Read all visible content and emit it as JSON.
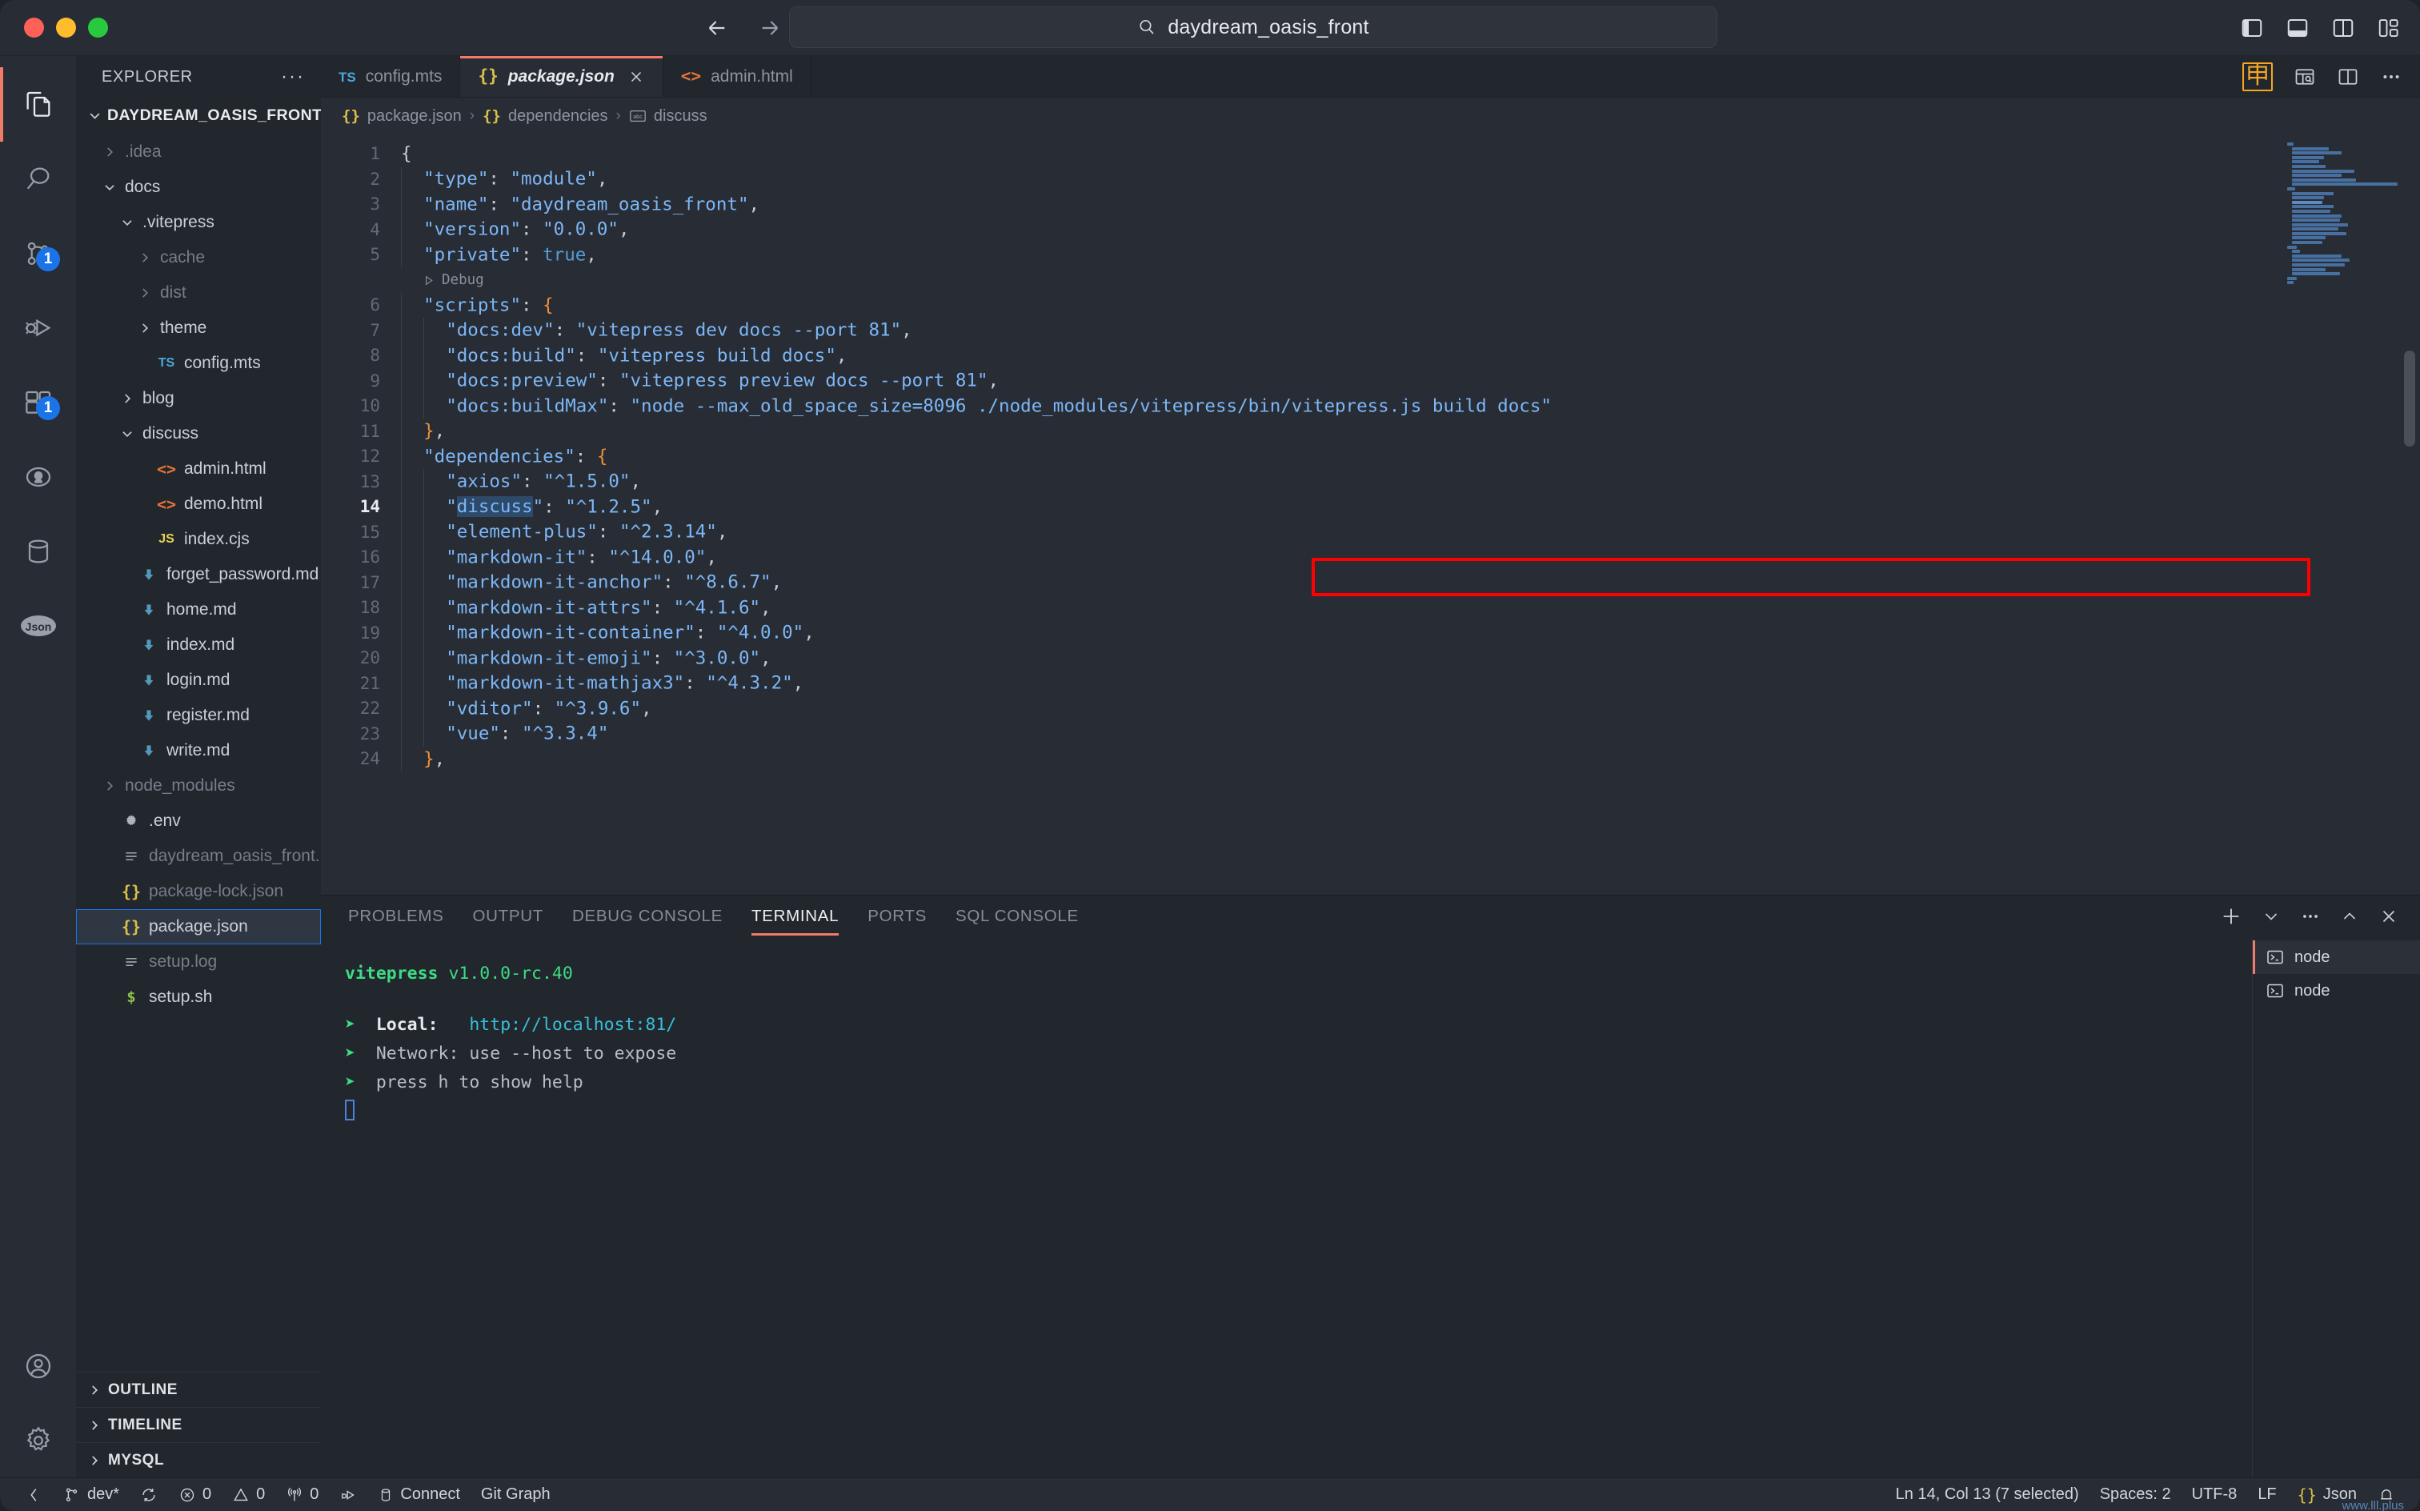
{
  "titlebar": {
    "search_text": "daydream_oasis_front",
    "search_icon": "search-icon",
    "back_icon": "back-arrow-icon",
    "forward_icon": "forward-arrow-icon",
    "layout_icons": [
      "toggle-primary-sidebar-icon",
      "toggle-panel-icon",
      "toggle-secondary-sidebar-icon",
      "customize-layout-icon"
    ]
  },
  "activitybar": {
    "items": [
      {
        "name": "explorer",
        "icon": "files-icon",
        "badge": ""
      },
      {
        "name": "search",
        "icon": "search-icon",
        "badge": ""
      },
      {
        "name": "source-control",
        "icon": "source-control-icon",
        "badge": "1"
      },
      {
        "name": "run-and-debug",
        "icon": "debug-icon",
        "badge": ""
      },
      {
        "name": "extensions",
        "icon": "extensions-icon",
        "badge": "1"
      },
      {
        "name": "github",
        "icon": "github-icon",
        "badge": ""
      },
      {
        "name": "database",
        "icon": "database-icon",
        "badge": ""
      },
      {
        "name": "json-viewer",
        "icon": "json-icon",
        "badge": ""
      }
    ],
    "bottom": [
      {
        "name": "accounts",
        "icon": "account-icon"
      },
      {
        "name": "settings",
        "icon": "gear-icon"
      }
    ]
  },
  "sidebar": {
    "title": "EXPLORER",
    "more_label": "···",
    "root": {
      "label": "DAYDREAM_OASIS_FRONT",
      "expanded": true,
      "actions": [
        "new-file-icon",
        "new-folder-icon",
        "refresh-icon",
        "collapse-all-icon"
      ]
    },
    "tree": [
      {
        "label": ".idea",
        "indent": 1,
        "type": "folder",
        "expanded": false,
        "dim": true
      },
      {
        "label": "docs",
        "indent": 1,
        "type": "folder",
        "expanded": true,
        "dim": false
      },
      {
        "label": ".vitepress",
        "indent": 2,
        "type": "folder",
        "expanded": true,
        "dim": false
      },
      {
        "label": "cache",
        "indent": 3,
        "type": "folder",
        "expanded": false,
        "dim": true
      },
      {
        "label": "dist",
        "indent": 3,
        "type": "folder",
        "expanded": false,
        "dim": true
      },
      {
        "label": "theme",
        "indent": 3,
        "type": "folder",
        "expanded": false,
        "dim": false
      },
      {
        "label": "config.mts",
        "indent": 3,
        "type": "ts",
        "dim": false
      },
      {
        "label": "blog",
        "indent": 2,
        "type": "folder",
        "expanded": false,
        "dim": false
      },
      {
        "label": "discuss",
        "indent": 2,
        "type": "folder",
        "expanded": true,
        "dim": false
      },
      {
        "label": "admin.html",
        "indent": 3,
        "type": "html",
        "dim": false
      },
      {
        "label": "demo.html",
        "indent": 3,
        "type": "html",
        "dim": false
      },
      {
        "label": "index.cjs",
        "indent": 3,
        "type": "js",
        "dim": false
      },
      {
        "label": "forget_password.md",
        "indent": 2,
        "type": "md",
        "dim": false
      },
      {
        "label": "home.md",
        "indent": 2,
        "type": "md",
        "dim": false
      },
      {
        "label": "index.md",
        "indent": 2,
        "type": "md",
        "dim": false
      },
      {
        "label": "login.md",
        "indent": 2,
        "type": "md",
        "dim": false
      },
      {
        "label": "register.md",
        "indent": 2,
        "type": "md",
        "dim": false
      },
      {
        "label": "write.md",
        "indent": 2,
        "type": "md",
        "dim": false
      },
      {
        "label": "node_modules",
        "indent": 1,
        "type": "folder",
        "expanded": false,
        "dim": true
      },
      {
        "label": ".env",
        "indent": 1,
        "type": "env",
        "dim": false
      },
      {
        "label": "daydream_oasis_front.log",
        "indent": 1,
        "type": "log",
        "dim": true
      },
      {
        "label": "package-lock.json",
        "indent": 1,
        "type": "json",
        "dim": true
      },
      {
        "label": "package.json",
        "indent": 1,
        "type": "json",
        "dim": false,
        "selected": true
      },
      {
        "label": "setup.log",
        "indent": 1,
        "type": "log",
        "dim": true
      },
      {
        "label": "setup.sh",
        "indent": 1,
        "type": "sh",
        "dim": false
      }
    ],
    "sections": [
      {
        "label": "OUTLINE"
      },
      {
        "label": "TIMELINE"
      },
      {
        "label": "MYSQL"
      }
    ]
  },
  "editor": {
    "tabs": [
      {
        "label": "config.mts",
        "icon": "ts-file-icon",
        "active": false,
        "closable": false
      },
      {
        "label": "package.json",
        "icon": "json-file-icon",
        "active": true,
        "closable": true
      },
      {
        "label": "admin.html",
        "icon": "html-file-icon",
        "active": false,
        "closable": false
      }
    ],
    "toolbar": [
      {
        "name": "chinese-ime-icon",
        "glyph": "申"
      },
      {
        "name": "open-preview-icon"
      },
      {
        "name": "split-editor-icon"
      },
      {
        "name": "more-actions-icon",
        "glyph": "···"
      }
    ],
    "breadcrumb": [
      {
        "label": "package.json",
        "icon": "json-file-icon"
      },
      {
        "label": "dependencies",
        "icon": "json-object-icon"
      },
      {
        "label": "discuss",
        "icon": "abc-property-icon"
      }
    ],
    "codelens": {
      "label": "Debug",
      "icon": "play-icon",
      "line": 6
    },
    "current_line": 14,
    "lines": [
      {
        "n": 1,
        "depth": 0,
        "tokens": [
          {
            "t": "{",
            "c": "p"
          }
        ]
      },
      {
        "n": 2,
        "depth": 1,
        "tokens": [
          {
            "t": "\"type\"",
            "c": "k"
          },
          {
            "t": ": ",
            "c": "p"
          },
          {
            "t": "\"module\"",
            "c": "s"
          },
          {
            "t": ",",
            "c": "p"
          }
        ]
      },
      {
        "n": 3,
        "depth": 1,
        "tokens": [
          {
            "t": "\"name\"",
            "c": "k"
          },
          {
            "t": ": ",
            "c": "p"
          },
          {
            "t": "\"daydream_oasis_front\"",
            "c": "s"
          },
          {
            "t": ",",
            "c": "p"
          }
        ]
      },
      {
        "n": 4,
        "depth": 1,
        "tokens": [
          {
            "t": "\"version\"",
            "c": "k"
          },
          {
            "t": ": ",
            "c": "p"
          },
          {
            "t": "\"0.0.0\"",
            "c": "s"
          },
          {
            "t": ",",
            "c": "p"
          }
        ]
      },
      {
        "n": 5,
        "depth": 1,
        "tokens": [
          {
            "t": "\"private\"",
            "c": "k"
          },
          {
            "t": ": ",
            "c": "p"
          },
          {
            "t": "true",
            "c": "bool"
          },
          {
            "t": ",",
            "c": "p"
          }
        ]
      },
      {
        "n": 6,
        "depth": 1,
        "tokens": [
          {
            "t": "\"scripts\"",
            "c": "k"
          },
          {
            "t": ": ",
            "c": "p"
          },
          {
            "t": "{",
            "c": "b"
          }
        ]
      },
      {
        "n": 7,
        "depth": 2,
        "tokens": [
          {
            "t": "\"docs:dev\"",
            "c": "k"
          },
          {
            "t": ": ",
            "c": "p"
          },
          {
            "t": "\"vitepress dev docs --port 81\"",
            "c": "s"
          },
          {
            "t": ",",
            "c": "p"
          }
        ]
      },
      {
        "n": 8,
        "depth": 2,
        "tokens": [
          {
            "t": "\"docs:build\"",
            "c": "k"
          },
          {
            "t": ": ",
            "c": "p"
          },
          {
            "t": "\"vitepress build docs\"",
            "c": "s"
          },
          {
            "t": ",",
            "c": "p"
          }
        ]
      },
      {
        "n": 9,
        "depth": 2,
        "tokens": [
          {
            "t": "\"docs:preview\"",
            "c": "k"
          },
          {
            "t": ": ",
            "c": "p"
          },
          {
            "t": "\"vitepress preview docs --port 81\"",
            "c": "s"
          },
          {
            "t": ",",
            "c": "p"
          }
        ]
      },
      {
        "n": 10,
        "depth": 2,
        "tokens": [
          {
            "t": "\"docs:buildMax\"",
            "c": "k"
          },
          {
            "t": ": ",
            "c": "p"
          },
          {
            "t": "\"node --max_old_space_size=8096 ./node_modules/vitepress/bin/vitepress.js build docs\"",
            "c": "s"
          }
        ]
      },
      {
        "n": 11,
        "depth": 1,
        "tokens": [
          {
            "t": "}",
            "c": "b"
          },
          {
            "t": ",",
            "c": "p"
          }
        ]
      },
      {
        "n": 12,
        "depth": 1,
        "tokens": [
          {
            "t": "\"dependencies\"",
            "c": "k"
          },
          {
            "t": ": ",
            "c": "p"
          },
          {
            "t": "{",
            "c": "b"
          }
        ]
      },
      {
        "n": 13,
        "depth": 2,
        "tokens": [
          {
            "t": "\"axios\"",
            "c": "k"
          },
          {
            "t": ": ",
            "c": "p"
          },
          {
            "t": "\"^1.5.0\"",
            "c": "s"
          },
          {
            "t": ",",
            "c": "p"
          }
        ]
      },
      {
        "n": 14,
        "depth": 2,
        "tokens": [
          {
            "t": "\"",
            "c": "k"
          },
          {
            "t": "discuss",
            "c": "k sel"
          },
          {
            "t": "\"",
            "c": "k"
          },
          {
            "t": ": ",
            "c": "p"
          },
          {
            "t": "\"^1.2.5\"",
            "c": "s"
          },
          {
            "t": ",",
            "c": "p"
          }
        ]
      },
      {
        "n": 15,
        "depth": 2,
        "tokens": [
          {
            "t": "\"element-plus\"",
            "c": "k"
          },
          {
            "t": ": ",
            "c": "p"
          },
          {
            "t": "\"^2.3.14\"",
            "c": "s"
          },
          {
            "t": ",",
            "c": "p"
          }
        ]
      },
      {
        "n": 16,
        "depth": 2,
        "tokens": [
          {
            "t": "\"markdown-it\"",
            "c": "k"
          },
          {
            "t": ": ",
            "c": "p"
          },
          {
            "t": "\"^14.0.0\"",
            "c": "s"
          },
          {
            "t": ",",
            "c": "p"
          }
        ]
      },
      {
        "n": 17,
        "depth": 2,
        "tokens": [
          {
            "t": "\"markdown-it-anchor\"",
            "c": "k"
          },
          {
            "t": ": ",
            "c": "p"
          },
          {
            "t": "\"^8.6.7\"",
            "c": "s"
          },
          {
            "t": ",",
            "c": "p"
          }
        ]
      },
      {
        "n": 18,
        "depth": 2,
        "tokens": [
          {
            "t": "\"markdown-it-attrs\"",
            "c": "k"
          },
          {
            "t": ": ",
            "c": "p"
          },
          {
            "t": "\"^4.1.6\"",
            "c": "s"
          },
          {
            "t": ",",
            "c": "p"
          }
        ]
      },
      {
        "n": 19,
        "depth": 2,
        "tokens": [
          {
            "t": "\"markdown-it-container\"",
            "c": "k"
          },
          {
            "t": ": ",
            "c": "p"
          },
          {
            "t": "\"^4.0.0\"",
            "c": "s"
          },
          {
            "t": ",",
            "c": "p"
          }
        ]
      },
      {
        "n": 20,
        "depth": 2,
        "tokens": [
          {
            "t": "\"markdown-it-emoji\"",
            "c": "k"
          },
          {
            "t": ": ",
            "c": "p"
          },
          {
            "t": "\"^3.0.0\"",
            "c": "s"
          },
          {
            "t": ",",
            "c": "p"
          }
        ]
      },
      {
        "n": 21,
        "depth": 2,
        "tokens": [
          {
            "t": "\"markdown-it-mathjax3\"",
            "c": "k"
          },
          {
            "t": ": ",
            "c": "p"
          },
          {
            "t": "\"^4.3.2\"",
            "c": "s"
          },
          {
            "t": ",",
            "c": "p"
          }
        ]
      },
      {
        "n": 22,
        "depth": 2,
        "tokens": [
          {
            "t": "\"vditor\"",
            "c": "k"
          },
          {
            "t": ": ",
            "c": "p"
          },
          {
            "t": "\"^3.9.6\"",
            "c": "s"
          },
          {
            "t": ",",
            "c": "p"
          }
        ]
      },
      {
        "n": 23,
        "depth": 2,
        "tokens": [
          {
            "t": "\"vue\"",
            "c": "k"
          },
          {
            "t": ": ",
            "c": "p"
          },
          {
            "t": "\"^3.3.4\"",
            "c": "s"
          }
        ]
      },
      {
        "n": 24,
        "depth": 1,
        "tokens": [
          {
            "t": "}",
            "c": "b"
          },
          {
            "t": ",",
            "c": "p"
          }
        ]
      }
    ],
    "highlight": {
      "name": "red-annotation-box",
      "color": "#ff0000",
      "line": 10
    }
  },
  "panel": {
    "tabs": [
      {
        "label": "PROBLEMS",
        "active": false
      },
      {
        "label": "OUTPUT",
        "active": false
      },
      {
        "label": "DEBUG CONSOLE",
        "active": false
      },
      {
        "label": "TERMINAL",
        "active": true
      },
      {
        "label": "PORTS",
        "active": false
      },
      {
        "label": "SQL CONSOLE",
        "active": false
      }
    ],
    "actions": [
      {
        "name": "new-terminal-icon",
        "glyph": "+"
      },
      {
        "name": "terminal-dropdown-icon",
        "glyph": "⌄"
      },
      {
        "name": "panel-more-icon",
        "glyph": "···"
      },
      {
        "name": "maximize-panel-icon",
        "glyph": "^"
      },
      {
        "name": "close-panel-icon",
        "glyph": "✕"
      }
    ],
    "terminal": {
      "header_name": "vitepress",
      "header_version": "v1.0.0-rc.40",
      "rows": [
        {
          "arrow": "➜",
          "label": "Local:",
          "sep": "   ",
          "value": "http://localhost:81/",
          "value_class": "cy",
          "label_class": "w"
        },
        {
          "arrow": "➜",
          "label": "Network:",
          "sep": " ",
          "value": "use --host to expose",
          "value_class": "",
          "label_class": ""
        },
        {
          "arrow": "➜",
          "label": "press h to show help",
          "sep": "",
          "value": "",
          "value_class": "",
          "label_class": ""
        }
      ],
      "cursor": "block-cursor"
    },
    "terminal_list": [
      {
        "label": "node",
        "icon": "terminal-icon",
        "active": true
      },
      {
        "label": "node",
        "icon": "terminal-icon",
        "active": false
      }
    ]
  },
  "statusbar": {
    "left": [
      {
        "name": "remote-window",
        "icon": "remote-icon",
        "label": ""
      },
      {
        "name": "branch",
        "icon": "branch-icon",
        "label": "dev*"
      },
      {
        "name": "sync",
        "icon": "sync-icon",
        "label": ""
      },
      {
        "name": "errors",
        "icon": "error-icon",
        "label": "0"
      },
      {
        "name": "warnings",
        "icon": "warning-icon",
        "label": "0"
      },
      {
        "name": "radio-tower",
        "icon": "radio-tower-icon",
        "label": "0"
      },
      {
        "name": "debug-start",
        "icon": "debug-icon",
        "label": ""
      },
      {
        "name": "database-connect",
        "icon": "database-icon",
        "label": "Connect"
      },
      {
        "name": "git-graph",
        "icon": "",
        "label": "Git Graph"
      }
    ],
    "right": [
      {
        "name": "cursor-position",
        "label": "Ln 14, Col 13 (7 selected)"
      },
      {
        "name": "indentation",
        "label": "Spaces: 2"
      },
      {
        "name": "encoding",
        "label": "UTF-8"
      },
      {
        "name": "eol",
        "label": "LF"
      },
      {
        "name": "language-mode",
        "label": "Json",
        "icon": "json-icon"
      },
      {
        "name": "notifications",
        "label": "",
        "icon": "bell-icon"
      }
    ],
    "watermark": "www.lll.plus"
  }
}
